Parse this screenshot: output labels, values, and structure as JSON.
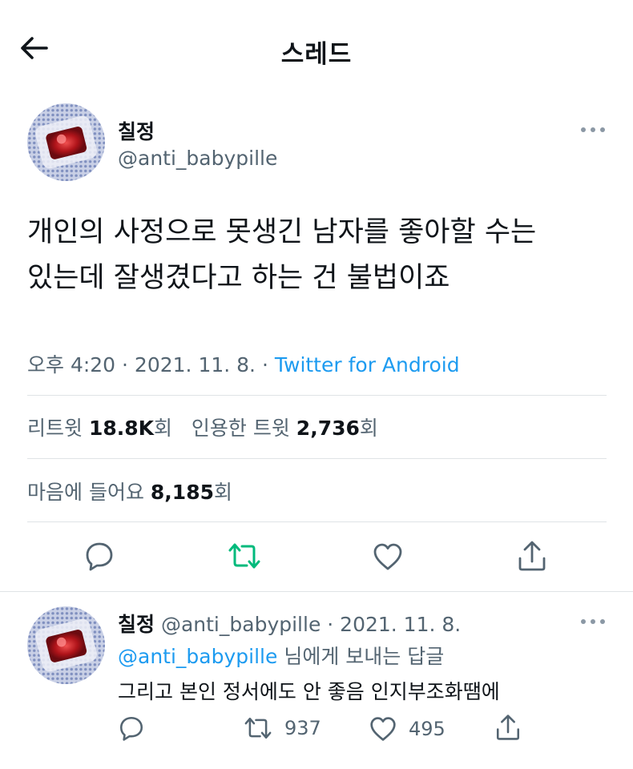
{
  "header": {
    "title": "스레드",
    "back_icon": "arrow-left-icon"
  },
  "tweet": {
    "author_name": "칠정",
    "author_handle": "@anti_babypille",
    "text_line1": "개인의 사정으로 못생긴 남자를 좋아할 수는",
    "text_line2": "있는데 잘생겼다고 하는 건 불법이죠",
    "time": "오후 4:20 · 2021. 11. 8. ·",
    "source": "Twitter for Android",
    "retweets_label": "리트윗",
    "retweets_count": "18.8K",
    "retweets_suffix": "회",
    "quotes_label": "인용한 트윗",
    "quotes_count": "2,736",
    "quotes_suffix": "회",
    "likes_label": "마음에 들어요",
    "likes_count": "8,185",
    "likes_suffix": "회"
  },
  "reply": {
    "author_name": "칠정",
    "handle_date": "@anti_babypille · 2021. 11. 8.",
    "replying_mention": "@anti_babypille",
    "replying_suffix": "님에게 보내는 답글",
    "text": "그리고 본인 정서에도 안 좋음 인지부조화땜에",
    "retweet_count": "937",
    "like_count": "495"
  },
  "colors": {
    "text": "#0f1419",
    "muted": "#536471",
    "link": "#1d9bf0",
    "retweet_green": "#00ba7c",
    "divider": "#dfe3e6"
  }
}
